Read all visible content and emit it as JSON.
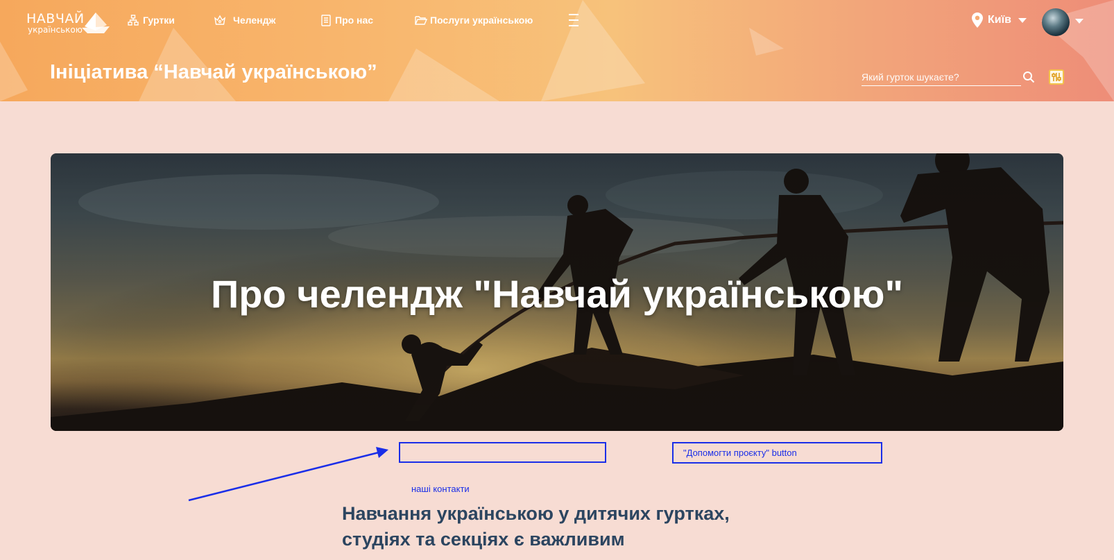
{
  "logo": {
    "line1": "НАВЧАЙ",
    "line2": "українською"
  },
  "nav": {
    "items": [
      {
        "label": "Гуртки",
        "icon": "sitemap-icon"
      },
      {
        "label": "Челендж",
        "icon": "crown-icon"
      },
      {
        "label": "Про нас",
        "icon": "document-icon"
      },
      {
        "label": "Послуги українською",
        "icon": "folder-open-icon"
      }
    ],
    "more_icon": "hamburger-icon"
  },
  "location": {
    "city": "Київ",
    "icon": "map-pin-icon"
  },
  "user": {
    "avatar_icon": "avatar-icon"
  },
  "header": {
    "title": "Ініціатива “Навчай українською”"
  },
  "search": {
    "placeholder": "Який гурток шукаєте?"
  },
  "banner": {
    "title": "Про челендж \"Навчай українською\""
  },
  "annotations": {
    "box2_label": "\"Допомогти проєкту\" button"
  },
  "contacts": {
    "link_label": "наші контакти"
  },
  "section": {
    "heading": "Навчання українською у дитячих гуртках, студіях та секціях є важливим"
  },
  "colors": {
    "annotation": "#1a2ee8",
    "heading": "#2c4560",
    "background": "#f7dcd3"
  }
}
